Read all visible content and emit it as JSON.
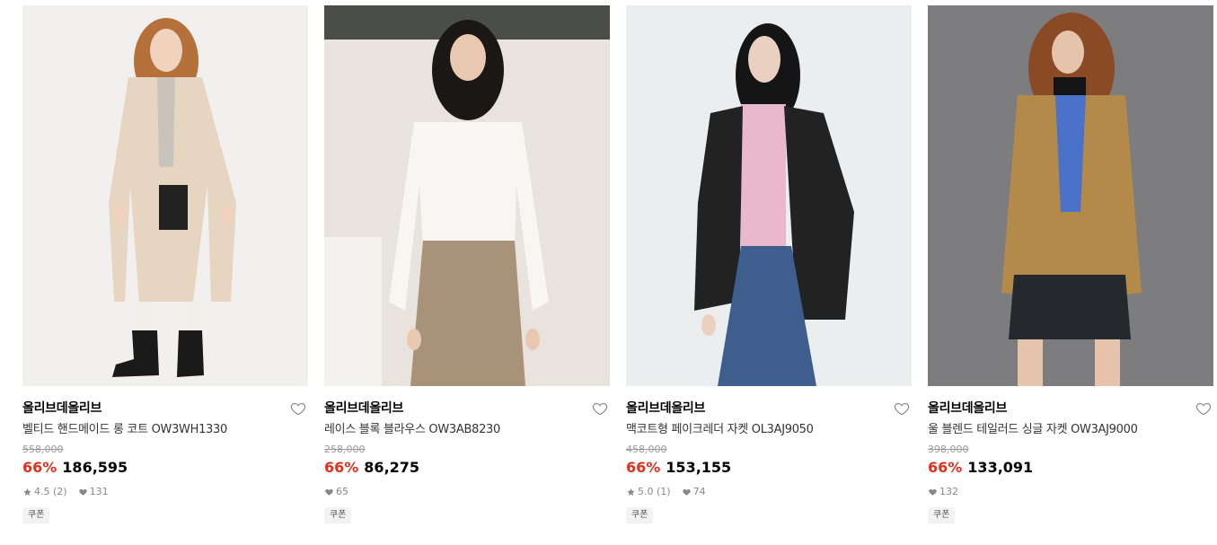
{
  "products": [
    {
      "brand": "올리브데올리브",
      "name": "벨티드 핸드메이드 롱 코트 OW3WH1330",
      "original_price": "558,000",
      "discount": "66%",
      "price": "186,595",
      "rating": "4.5",
      "review_count": "(2)",
      "likes": "131",
      "coupon": "쿠폰",
      "image_icon": "long-beige-coat-photo"
    },
    {
      "brand": "올리브데올리브",
      "name": "레이스 블록 블라우스 OW3AB8230",
      "original_price": "258,000",
      "discount": "66%",
      "price": "86,275",
      "rating": "",
      "review_count": "",
      "likes": "65",
      "coupon": "쿠폰",
      "image_icon": "white-blouse-photo"
    },
    {
      "brand": "올리브데올리브",
      "name": "맥코트형 페이크레더 자켓 OL3AJ9050",
      "original_price": "458,000",
      "discount": "66%",
      "price": "153,155",
      "rating": "5.0",
      "review_count": "(1)",
      "likes": "74",
      "coupon": "쿠폰",
      "image_icon": "black-leather-jacket-photo"
    },
    {
      "brand": "올리브데올리브",
      "name": "울 블렌드 테일러드 싱글 자켓 OW3AJ9000",
      "original_price": "398,000",
      "discount": "66%",
      "price": "133,091",
      "rating": "",
      "review_count": "",
      "likes": "132",
      "coupon": "쿠폰",
      "image_icon": "camel-tailored-jacket-photo"
    }
  ],
  "colors": {
    "discount": "#e0301e",
    "muted": "#888888",
    "coupon_bg": "#f2f2f2"
  }
}
